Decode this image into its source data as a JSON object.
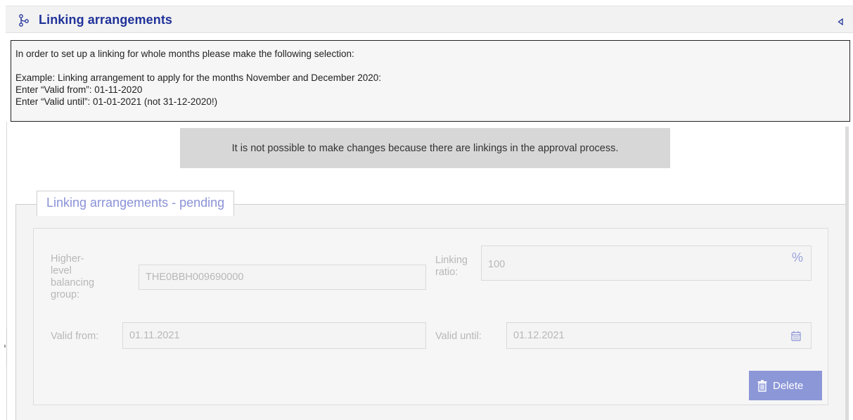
{
  "panel": {
    "title": "Linking arrangements"
  },
  "info": {
    "line1": "In order to set up a linking for whole months please make the following selection:",
    "line2": "Example: Linking arrangement to apply for the months November and December 2020:",
    "line3": "Enter “Valid from”: 01-11-2020",
    "line4": "Enter “Valid until”: 01-01-2021 (not 31-12-2020!)"
  },
  "notice": "It is not possible to make changes because there are linkings in the approval process.",
  "pending": {
    "legend": "Linking arrangements - pending",
    "higher_level_label": "Higher-level balancing group:",
    "higher_level_label_lines": [
      "Higher-",
      "level",
      "balancing",
      "group:"
    ],
    "higher_level_value": "THE0BBH009690000",
    "linking_ratio_label_lines": [
      "Linking",
      "ratio:"
    ],
    "linking_ratio_value": "100",
    "linking_ratio_unit": "%",
    "valid_from_label": "Valid from:",
    "valid_from_value": "01.11.2021",
    "valid_until_label": "Valid until:",
    "valid_until_value": "01.12.2021",
    "delete_label": "Delete"
  },
  "icons": {
    "header": "linking-icon",
    "collapse": "collapse-triangle-icon",
    "calendar": "calendar-icon",
    "delete": "trash-icon"
  },
  "colors": {
    "title": "#20329a",
    "legend": "#8a92d6",
    "button": "#8c97d8"
  }
}
